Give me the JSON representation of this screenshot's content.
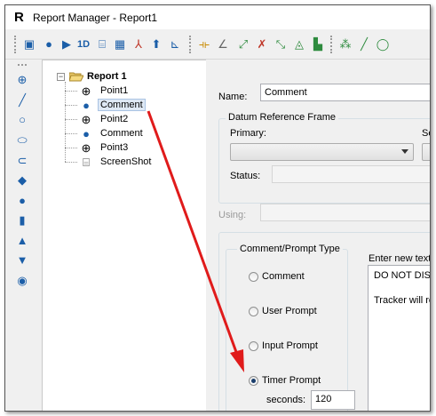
{
  "window": {
    "app_icon_letter": "R",
    "title": "Report Manager - Report1"
  },
  "toolbar": {
    "icons": [
      "save-icon",
      "comment-icon",
      "play-icon",
      "1d-icon",
      "camera-icon",
      "grid-icon",
      "axes-icon",
      "import-icon",
      "axes-plus-icon",
      "dimension-icon",
      "angle-icon",
      "line-point-icon",
      "cross-icon",
      "line-cross-icon",
      "target-icon",
      "chart-icon",
      "sparkle-icon",
      "slash-icon",
      "circle-icon"
    ],
    "label_1d": "1D"
  },
  "lefttools": {
    "icons": [
      "point-icon",
      "line-icon",
      "circle-icon",
      "ellipse-icon",
      "slot-icon",
      "plane-icon",
      "sphere-icon",
      "cylinder-icon",
      "cone-icon",
      "torus-icon",
      "ring-icon"
    ]
  },
  "tree": {
    "root_label": "Report 1",
    "nodes": [
      {
        "label": "Point1",
        "icon": "point-icon"
      },
      {
        "label": "Comment",
        "icon": "comment-icon"
      },
      {
        "label": "Point2",
        "icon": "point-icon"
      },
      {
        "label": "Comment",
        "icon": "comment-icon"
      },
      {
        "label": "Point3",
        "icon": "point-icon"
      },
      {
        "label": "ScreenShot",
        "icon": "screenshot-icon"
      }
    ]
  },
  "form": {
    "name_label": "Name:",
    "name_value": "Comment",
    "datum_group_title": "Datum Reference Frame",
    "primary_label": "Primary:",
    "secondary_label_partial": "Se",
    "status_label": "Status:",
    "using_label": "Using:",
    "comment_type_group_title": "Comment/Prompt Type",
    "radio_options": [
      {
        "label": "Comment",
        "checked": false
      },
      {
        "label": "User Prompt",
        "checked": false
      },
      {
        "label": "Input Prompt",
        "checked": false
      },
      {
        "label": "Timer Prompt",
        "checked": true
      }
    ],
    "seconds_label": "seconds:",
    "seconds_value": "120",
    "enter_text_label": "Enter new text.",
    "text_line1": "DO NOT DISTU",
    "text_line2": "Tracker will res"
  },
  "colors": {
    "annotation_arrow": "#e01b1b",
    "icon_blue": "#1b5ea8"
  }
}
